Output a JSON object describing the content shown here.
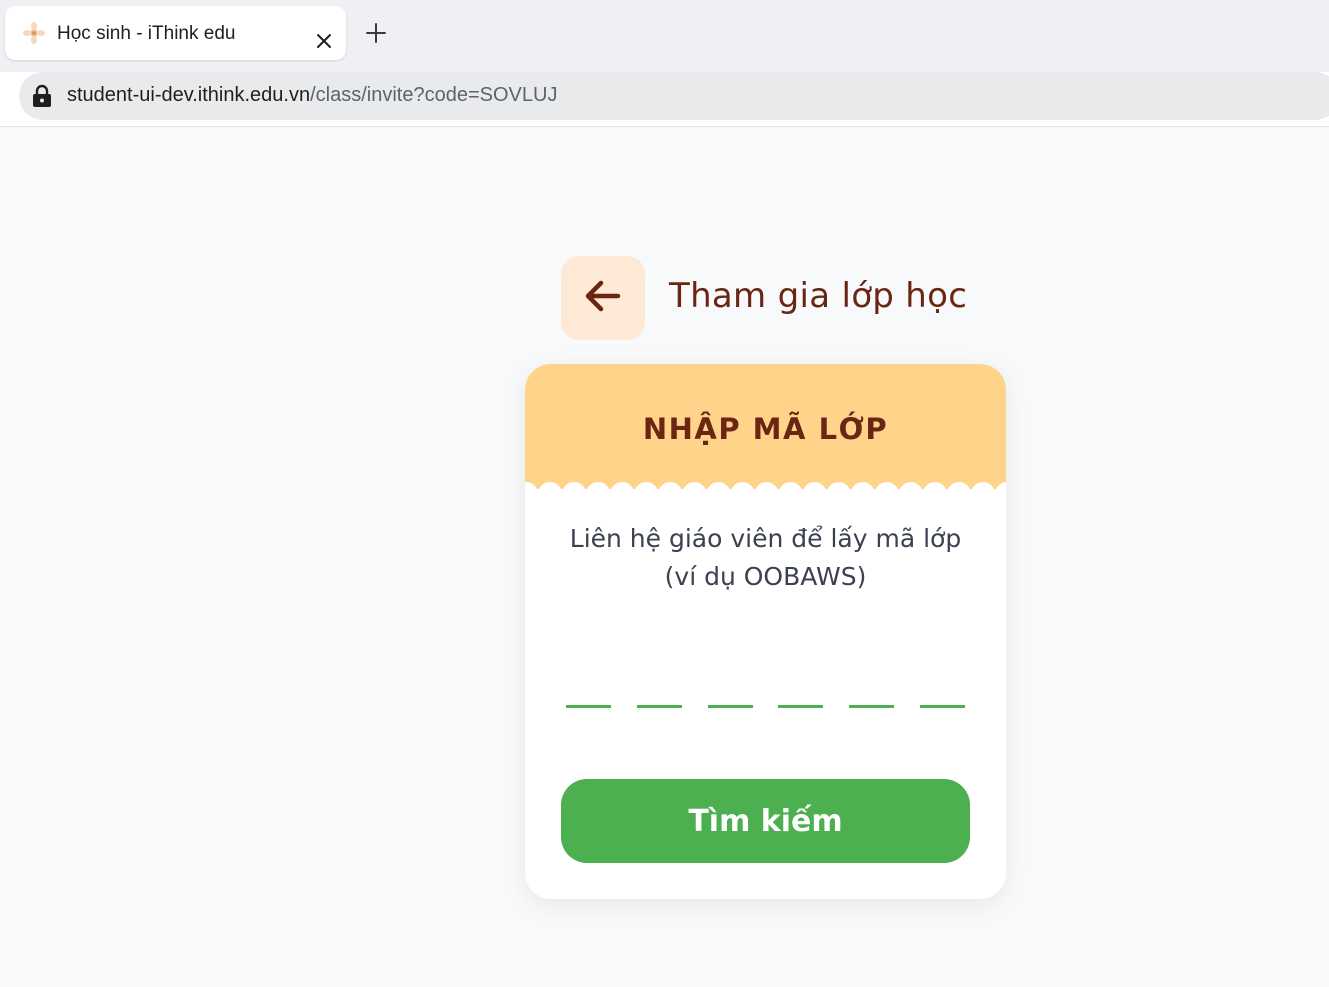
{
  "browser": {
    "tab_title": "Học sinh - iThink edu",
    "url_host": "student-ui-dev.ithink.edu.vn",
    "url_path": "/class/invite?code=SOVLUJ"
  },
  "page": {
    "title": "Tham gia lớp học",
    "card": {
      "heading": "NHẬP MÃ LỚP",
      "instruction_line1": "Liên hệ giáo viên để lấy mã lớp",
      "instruction_line2": "(ví dụ OOBAWS)",
      "code_slots": [
        "",
        "",
        "",
        "",
        "",
        ""
      ],
      "search_label": "Tìm kiếm"
    }
  },
  "colors": {
    "brand_brown": "#6a2612",
    "header_yellow": "#ffd389",
    "accent_green": "#4caf50",
    "back_button_bg": "#fde9d6"
  },
  "icons": {
    "favicon": "ithink-logo-icon",
    "tab_close": "close-icon",
    "new_tab": "plus-icon",
    "lock": "lock-icon",
    "back": "arrow-left-icon"
  }
}
